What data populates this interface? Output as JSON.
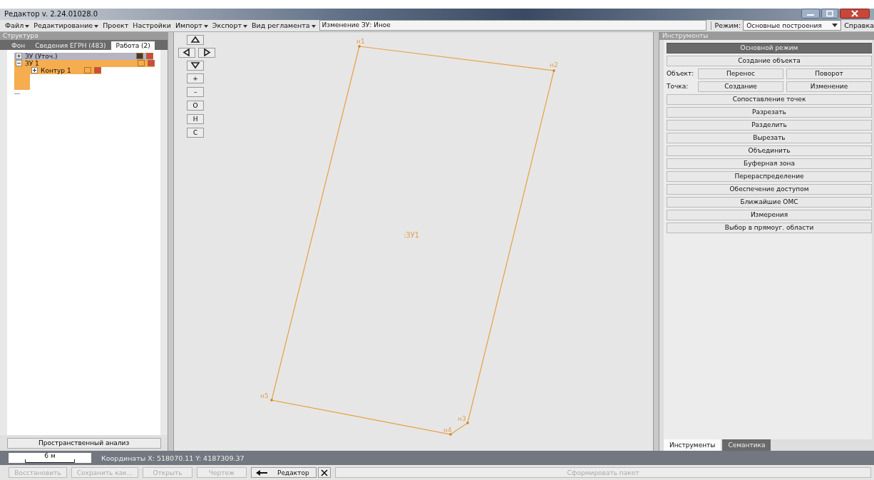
{
  "window": {
    "title": "Редактор v. 2.24.01028.0"
  },
  "menu": [
    {
      "label": "Файл",
      "dropdown": true
    },
    {
      "label": "Редактирование",
      "dropdown": true
    },
    {
      "label": "Проект",
      "dropdown": false
    },
    {
      "label": "Настройки",
      "dropdown": false
    },
    {
      "label": "Импорт",
      "dropdown": true
    },
    {
      "label": "Экспорт",
      "dropdown": true
    },
    {
      "label": "Вид регламента",
      "dropdown": true
    }
  ],
  "operation_field": {
    "value": "Изменение ЗУ: Иное"
  },
  "mode": {
    "label": "Режим:",
    "value": "Основные построения"
  },
  "help": {
    "label": "Справка"
  },
  "structure": {
    "title": "Структура",
    "tabs": [
      {
        "label": "Фон",
        "selected": false
      },
      {
        "label": "Сведения ЕГРН (483)",
        "selected": false
      },
      {
        "label": "Работа (2)",
        "selected": true
      }
    ],
    "tree": [
      {
        "kind": "node",
        "label": "ЗУ (Уточ.)",
        "expanded": false,
        "selected": false,
        "swatches": [
          {
            "color": "#3c3c3c"
          },
          {
            "color": "#d04848"
          }
        ]
      },
      {
        "kind": "node",
        "label": "ЗУ 1",
        "expanded": true,
        "selected": true,
        "swatches": [
          {
            "color": "#f5ad50"
          },
          {
            "color": "#d04848"
          }
        ],
        "children": [
          {
            "kind": "node",
            "label": "Контур 1",
            "expanded": false,
            "selected": true,
            "swatches": [
              {
                "color": "#f5ad50"
              },
              {
                "color": "#d04848"
              }
            ]
          },
          {
            "kind": "empty"
          },
          {
            "kind": "empty"
          }
        ]
      },
      {
        "kind": "empty"
      }
    ],
    "analysis_button": "Пространственный анализ"
  },
  "map": {
    "nav_buttons": [
      {
        "kind": "up"
      },
      {
        "kind": "left"
      },
      {
        "kind": "right"
      },
      {
        "kind": "down"
      },
      {
        "kind": "text",
        "label": "+"
      },
      {
        "kind": "text",
        "label": "–"
      },
      {
        "kind": "text",
        "label": "О"
      },
      {
        "kind": "text",
        "label": "Н"
      },
      {
        "kind": "text",
        "label": "С"
      }
    ],
    "parcel_label": ":ЗУ1",
    "points": [
      {
        "label": "н1"
      },
      {
        "label": "н2"
      },
      {
        "label": "н3"
      },
      {
        "label": "н4"
      },
      {
        "label": "н5"
      }
    ]
  },
  "tools": {
    "title": "Инструменты",
    "rows": [
      {
        "kind": "button",
        "label": "Основной режим",
        "selected": true
      },
      {
        "kind": "button",
        "label": "Создание объекта",
        "selected": false
      },
      {
        "kind": "pair",
        "label": "Объект:",
        "buttons": [
          "Перенос",
          "Поворот"
        ]
      },
      {
        "kind": "pair",
        "label": "Точка:",
        "buttons": [
          "Создание",
          "Изменение"
        ]
      },
      {
        "kind": "button",
        "label": "Сопоставление точек",
        "selected": false
      },
      {
        "kind": "button",
        "label": "Разрезать",
        "selected": false
      },
      {
        "kind": "button",
        "label": "Разделить",
        "selected": false
      },
      {
        "kind": "button",
        "label": "Вырезать",
        "selected": false
      },
      {
        "kind": "button",
        "label": "Объединить",
        "selected": false
      },
      {
        "kind": "button",
        "label": "Буферная зона",
        "selected": false
      },
      {
        "kind": "button",
        "label": "Перераспределение",
        "selected": false
      },
      {
        "kind": "button",
        "label": "Обеспечение доступом",
        "selected": false
      },
      {
        "kind": "button",
        "label": "Ближайшие ОМС",
        "selected": false
      },
      {
        "kind": "button",
        "label": "Измерения",
        "selected": false
      },
      {
        "kind": "button",
        "label": "Выбор в прямоуг. области",
        "selected": false
      }
    ],
    "tabs": [
      {
        "label": "Инструменты",
        "selected": true
      },
      {
        "label": "Семантика",
        "selected": false
      }
    ]
  },
  "status_bar": {
    "scale": "6 м",
    "coordinates": "Координаты  X: 518070.11 Y: 4187309.37"
  },
  "bottom_buttons": [
    {
      "kind": "button",
      "label": "Восстановить",
      "disabled": true
    },
    {
      "kind": "button",
      "label": "Сохранить как...",
      "disabled": true
    },
    {
      "kind": "button",
      "label": "Открыть",
      "disabled": true
    },
    {
      "kind": "button",
      "label": "Чертеж",
      "disabled": true
    },
    {
      "kind": "back",
      "label": "Редактор",
      "disabled": false
    },
    {
      "kind": "close",
      "disabled": false
    },
    {
      "kind": "wide",
      "label": "Сформировать пакет",
      "disabled": true
    }
  ]
}
